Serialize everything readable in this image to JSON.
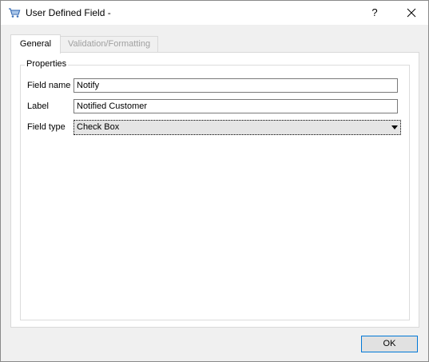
{
  "window": {
    "title": "User Defined Field -",
    "help_label": "?"
  },
  "tabs": [
    {
      "label": "General",
      "active": true
    },
    {
      "label": "Validation/Formatting",
      "active": false
    }
  ],
  "properties": {
    "group_title": "Properties",
    "field_name_label": "Field name",
    "field_name_value": "Notify",
    "label_label": "Label",
    "label_value": "Notified Customer",
    "field_type_label": "Field type",
    "field_type_value": "Check Box"
  },
  "footer": {
    "ok_label": "OK"
  },
  "icons": {
    "app": "cart-icon",
    "close": "close-icon",
    "dropdown": "chevron-down-icon"
  }
}
